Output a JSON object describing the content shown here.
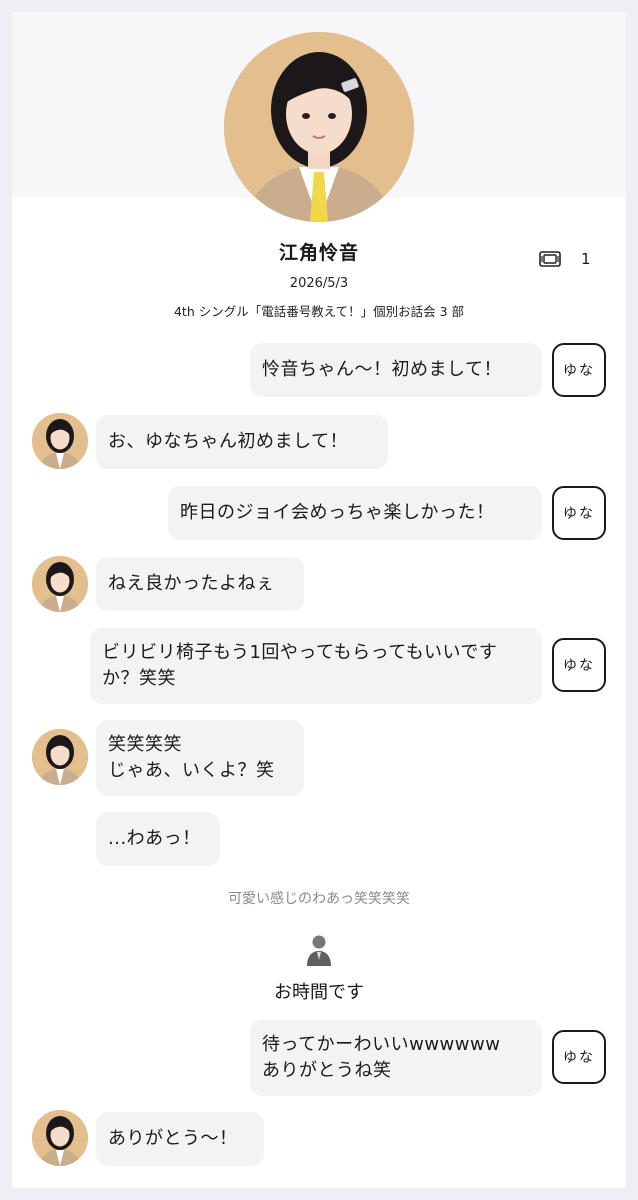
{
  "profile": {
    "name": "江角怜音",
    "event_date": "2026/5/3",
    "event_title": "4th シングル「電話番号教えて！」個別お話会 3 部",
    "ticket_icon": "ticket-icon",
    "ticket_count": "1"
  },
  "messages": [
    {
      "sender": "user",
      "text": "怜音ちゃん〜！初めまして！",
      "badge": "ゆな"
    },
    {
      "sender": "idol",
      "text": "お、ゆなちゃん初めまして！"
    },
    {
      "sender": "user",
      "text": "昨日のジョイ会めっちゃ楽しかった！",
      "badge": "ゆな"
    },
    {
      "sender": "idol",
      "text": "ねえ良かったよねぇ"
    },
    {
      "sender": "user",
      "text": "ビリビリ椅子もう1回やってもらってもいいですか？笑笑",
      "badge": "ゆな"
    },
    {
      "sender": "idol",
      "text": "笑笑笑笑\nじゃあ、いくよ？笑"
    },
    {
      "sender": "idol",
      "text": "...わあっ！"
    },
    {
      "sender": "user",
      "text": "待ってかーわいいwwwwww\nありがとうね笑",
      "badge": "ゆな"
    },
    {
      "sender": "idol",
      "text": "ありがとう〜！"
    }
  ],
  "system": {
    "note": "可愛い感じのわあっ笑笑笑笑",
    "staff_icon": "staff-person-icon",
    "time_up": "お時間です"
  },
  "colors": {
    "bubble": "#f3f3f4",
    "page_background": "#efeef5",
    "avatar_background": "#e4bf8e"
  }
}
